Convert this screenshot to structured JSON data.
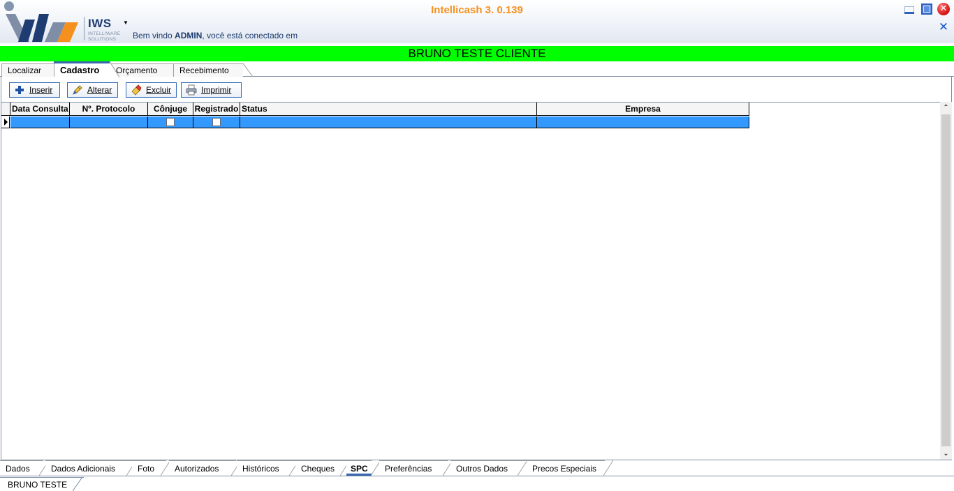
{
  "app": {
    "title": "Intellicash 3. 0.139",
    "welcome_prefix": "Bem vindo ",
    "welcome_user": "ADMIN",
    "welcome_suffix": ", você está conectado em",
    "logo_text": "IWS",
    "logo_sub1": "INTELLIWARE",
    "logo_sub2": "SOLUTIONS"
  },
  "client_bar": {
    "name": "BRUNO TESTE CLIENTE",
    "color": "#00ff00"
  },
  "top_tabs": [
    {
      "label": "Localizar"
    },
    {
      "label": "Cadastro",
      "active": true
    },
    {
      "label": "Orçamento"
    },
    {
      "label": "Recebimento"
    }
  ],
  "toolbar": {
    "inserir": "Inserir",
    "alterar": "Alterar",
    "excluir": "Excluir",
    "imprimir": "Imprimir"
  },
  "grid": {
    "columns": [
      "Data Consulta",
      "Nº. Protocolo",
      "Cônjuge",
      "Registrado",
      "Status",
      "Empresa"
    ],
    "rows": [
      {
        "data_consulta": "",
        "protocolo": "",
        "conjuge": false,
        "registrado": false,
        "status": "",
        "empresa": "",
        "selected": true
      }
    ],
    "selection_color": "#3399ff"
  },
  "bottom_tabs": [
    {
      "label": "Dados"
    },
    {
      "label": "Dados Adicionais"
    },
    {
      "label": "Foto"
    },
    {
      "label": "Autorizados"
    },
    {
      "label": "Históricos"
    },
    {
      "label": "Cheques"
    },
    {
      "label": "SPC",
      "active": true
    },
    {
      "label": "Preferências"
    },
    {
      "label": "Outros Dados"
    },
    {
      "label": "Precos Especiais"
    }
  ],
  "status_tab": {
    "label": "BRUNO TESTE"
  },
  "icons": {
    "inserir": "plus-icon",
    "alterar": "pencil-icon",
    "excluir": "eraser-icon",
    "imprimir": "printer-icon"
  },
  "colors": {
    "title": "#f5901e",
    "accent": "#3067b8"
  }
}
